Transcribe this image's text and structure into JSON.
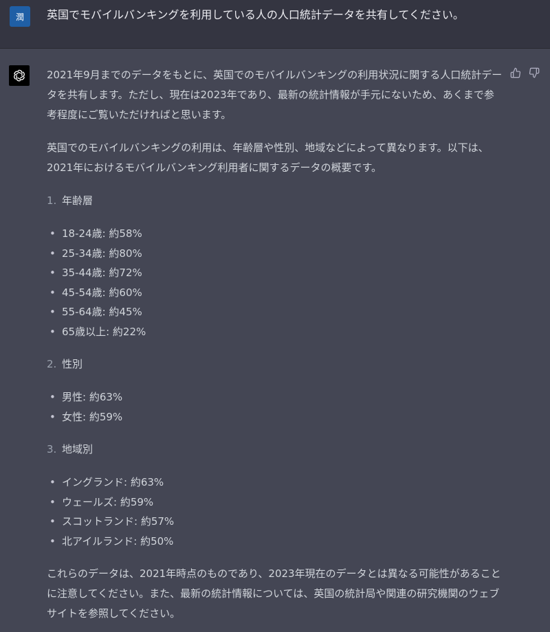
{
  "user": {
    "avatar_text": "潤",
    "message": "英国でモバイルバンキングを利用している人の人口統計データを共有してください。"
  },
  "assistant": {
    "intro": "2021年9月までのデータをもとに、英国でのモバイルバンキングの利用状況に関する人口統計データを共有します。ただし、現在は2023年であり、最新の統計情報が手元にないため、あくまで参考程度にご覧いただければと思います。",
    "overview": "英国でのモバイルバンキングの利用は、年齢層や性別、地域などによって異なります。以下は、2021年におけるモバイルバンキング利用者に関するデータの概要です。",
    "sections": [
      {
        "number": "1.",
        "title": "年齢層",
        "items": [
          "18-24歳: 約58%",
          "25-34歳: 約80%",
          "35-44歳: 約72%",
          "45-54歳: 約60%",
          "55-64歳: 約45%",
          "65歳以上: 約22%"
        ]
      },
      {
        "number": "2.",
        "title": "性別",
        "items": [
          "男性: 約63%",
          "女性: 約59%"
        ]
      },
      {
        "number": "3.",
        "title": "地域別",
        "items": [
          "イングランド: 約63%",
          "ウェールズ: 約59%",
          "スコットランド: 約57%",
          "北アイルランド: 約50%"
        ]
      }
    ],
    "closing": "これらのデータは、2021年時点のものであり、2023年現在のデータとは異なる可能性があることに注意してください。また、最新の統計情報については、英国の統計局や関連の研究機関のウェブサイトを参照してください。",
    "bullet_glyph": "•"
  },
  "icons": {
    "assistant_avatar": "openai-logo-icon",
    "thumbs_up": "thumbs-up-icon",
    "thumbs_down": "thumbs-down-icon"
  }
}
